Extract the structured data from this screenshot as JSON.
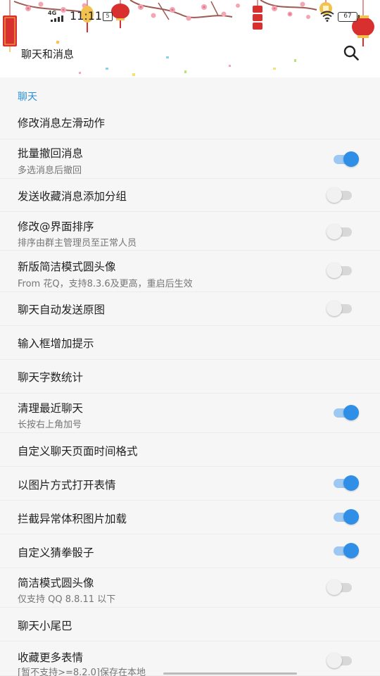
{
  "status_bar": {
    "network": "4G",
    "time": "11:11",
    "sim": "5",
    "battery": "67"
  },
  "header": {
    "title": "聊天和消息",
    "search_icon": "search-icon"
  },
  "colors": {
    "accent": "#2f8fe7",
    "section_title": "#2a8fd9",
    "toggle_off_track": "#d8d8d8",
    "toggle_off_knob": "#f1f1f1"
  },
  "section": {
    "title": "聊天"
  },
  "items": [
    {
      "title": "修改消息左滑动作",
      "subtitle": "",
      "toggle": null
    },
    {
      "title": "批量撤回消息",
      "subtitle": "多选消息后撤回",
      "toggle": true
    },
    {
      "title": "发送收藏消息添加分组",
      "subtitle": "",
      "toggle": false
    },
    {
      "title": "修改@界面排序",
      "subtitle": "排序由群主管理员至正常人员",
      "toggle": false
    },
    {
      "title": "新版简洁模式圆头像",
      "subtitle": "From 花Q，支持8.3.6及更高，重启后生效",
      "toggle": false
    },
    {
      "title": "聊天自动发送原图",
      "subtitle": "",
      "toggle": false
    },
    {
      "title": "输入框增加提示",
      "subtitle": "",
      "toggle": null
    },
    {
      "title": "聊天字数统计",
      "subtitle": "",
      "toggle": null
    },
    {
      "title": "清理最近聊天",
      "subtitle": "长按右上角加号",
      "toggle": true
    },
    {
      "title": "自定义聊天页面时间格式",
      "subtitle": "",
      "toggle": null
    },
    {
      "title": "以图片方式打开表情",
      "subtitle": "",
      "toggle": true
    },
    {
      "title": "拦截异常体积图片加载",
      "subtitle": "",
      "toggle": true
    },
    {
      "title": "自定义猜拳骰子",
      "subtitle": "",
      "toggle": true
    },
    {
      "title": "简洁模式圆头像",
      "subtitle": "仅支持 QQ 8.8.11 以下",
      "toggle": false
    },
    {
      "title": "聊天小尾巴",
      "subtitle": "",
      "toggle": null
    },
    {
      "title": "收藏更多表情",
      "subtitle": "[暂不支持>=8.2.0]保存在本地",
      "toggle": false
    }
  ]
}
